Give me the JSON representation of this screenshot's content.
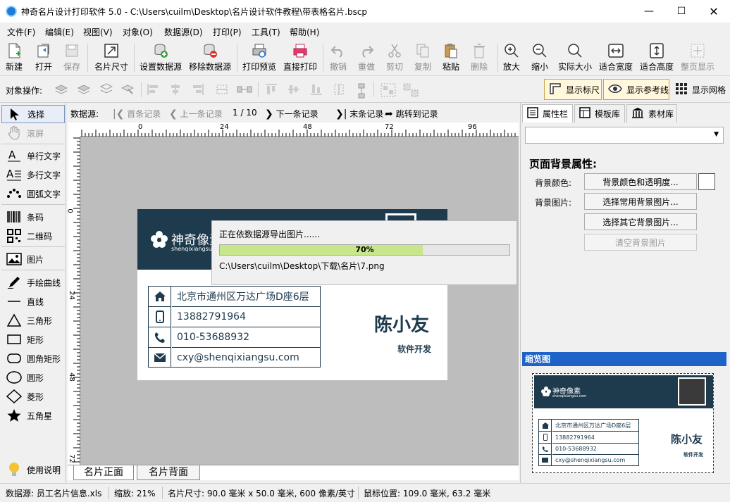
{
  "window": {
    "title": "神奇名片设计打印软件 5.0 - C:\\Users\\cuilm\\Desktop\\名片设计软件教程\\带表格名片.bscp"
  },
  "menu": [
    "文件(F)",
    "编辑(E)",
    "视图(V)",
    "对象(O)",
    "数据源(D)",
    "打印(P)",
    "工具(T)",
    "帮助(H)"
  ],
  "toolbar": {
    "new": "新建",
    "open": "打开",
    "save": "保存",
    "card_size": "名片尺寸",
    "set_ds": "设置数据源",
    "remove_ds": "移除数据源",
    "print_preview": "打印预览",
    "direct_print": "直接打印",
    "undo": "撤销",
    "redo": "重做",
    "cut": "剪切",
    "copy": "复制",
    "paste": "粘贴",
    "delete": "删除",
    "zoom_in": "放大",
    "zoom_out": "缩小",
    "actual_size": "实际大小",
    "fit_width": "适合宽度",
    "fit_height": "适合高度",
    "fit_page": "整页显示"
  },
  "objbar": {
    "label": "对象操作:",
    "show_ruler": "显示标尺",
    "show_guides": "显示参考线",
    "show_grid": "显示网格"
  },
  "tools": [
    "选择",
    "滚屏",
    "单行文字",
    "多行文字",
    "圆弧文字",
    "条码",
    "二维码",
    "图片",
    "手绘曲线",
    "直线",
    "三角形",
    "矩形",
    "圆角矩形",
    "圆形",
    "菱形",
    "五角星",
    "使用说明"
  ],
  "recnav": {
    "label": "数据源:",
    "first": "首条记录",
    "prev": "上一条记录",
    "counter": "1 / 10",
    "next": "下一条记录",
    "last": "末条记录",
    "jump": "跳转到记录"
  },
  "ruler": {
    "top": [
      "0",
      "24",
      "48",
      "72",
      "96"
    ],
    "left": [
      "0",
      "24",
      "48",
      "72"
    ]
  },
  "card": {
    "brand": "神奇像素",
    "site": "shenqixiangsu.com",
    "address": "北京市通州区万达广场D座6层",
    "phone": "13882791964",
    "tel": "010-53688932",
    "email": "cxy@shenqixiangsu.com",
    "name": "陈小友",
    "job": "软件开发"
  },
  "export": {
    "message": "正在依数据源导出图片......",
    "progress": 0.7,
    "progress_text": "70%",
    "path": "C:\\Users\\cuilm\\Desktop\\下载\\名片\\7.png"
  },
  "tabs": [
    "名片正面",
    "名片背面"
  ],
  "rpanel": {
    "tabs": [
      "属性栏",
      "模板库",
      "素材库"
    ],
    "section": "页面背景属性:",
    "bg_color_label": "背景颜色:",
    "bg_color_btn": "背景颜色和透明度...",
    "bg_img_label": "背景图片:",
    "bg_img_common": "选择常用背景图片...",
    "bg_img_other": "选择其它背景图片...",
    "bg_img_clear": "清空背景图片",
    "preview_title": "缩览图"
  },
  "status": {
    "ds": "数据源: 员工名片信息.xls",
    "zoom": "缩放: 21%",
    "size": "名片尺寸: 90.0 毫米 x 50.0 毫米, 600 像素/英寸",
    "mouse": "鼠标位置: 109.0 毫米, 63.2 毫米"
  },
  "colors": {
    "card_dark": "#1e3a4d",
    "accent": "#1e64c8",
    "progress": "#c8e68a"
  }
}
